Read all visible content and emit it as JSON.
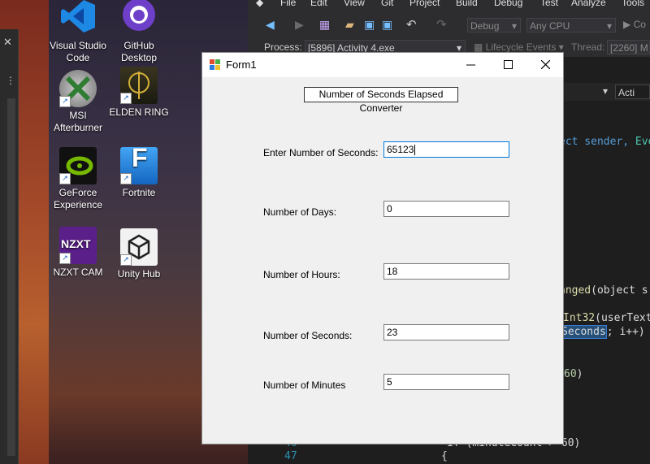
{
  "desktop": {
    "icons": [
      {
        "label": "Visual Studio Code",
        "icon": "vscode-icon",
        "color": "#1e88e5"
      },
      {
        "label": "GitHub Desktop",
        "icon": "github-desktop-icon",
        "color": "#6e40c9"
      },
      {
        "label": "MSI Afterburner",
        "icon": "msi-afterburner-icon",
        "color": "#c0c0c0"
      },
      {
        "label": "ELDEN RING",
        "icon": "elden-ring-icon",
        "color": "#2a2a1a"
      },
      {
        "label": "GeForce Experience",
        "icon": "geforce-experience-icon",
        "color": "#76b900"
      },
      {
        "label": "Fortnite",
        "icon": "fortnite-icon",
        "color": "#2196f3"
      },
      {
        "label": "NZXT CAM",
        "icon": "nzxt-cam-icon",
        "color": "#6a1b9a"
      },
      {
        "label": "Unity Hub",
        "icon": "unity-hub-icon",
        "color": "#f2f2f2"
      }
    ]
  },
  "vs": {
    "menu": [
      "File",
      "Edit",
      "View",
      "Git",
      "Project",
      "Build",
      "Debug",
      "Test",
      "Analyze",
      "Tools"
    ],
    "config": "Debug",
    "platform": "Any CPU",
    "partial_button": "Co",
    "process_label": "Process:",
    "process_value": "[5896] Activity 4.exe",
    "lifecycle": "Lifecycle Events",
    "thread_label": "Thread:",
    "thread_value": "[2260] M",
    "nav_right": "Acti",
    "code": {
      "line1_kw": "ect sender, ",
      "line1_ty": "Eve",
      "line2_fn": "anged",
      "line2_rest": "(object s",
      "line3_fn": "Int32",
      "line3_rest": "(userText",
      "line4_hl": "Seconds",
      "line4_rest": "; i++)",
      "line5_num": "60",
      "line5_rest": ")",
      "line6_text": "if (minuteCount > 60)",
      "line_no_46": "46",
      "line_no_47": "47",
      "brace": "{"
    }
  },
  "form": {
    "title": "Form1",
    "heading": "Number of Seconds Elapsed Converter",
    "fields": [
      {
        "label": "Enter Number of Seconds:",
        "value": "65123"
      },
      {
        "label": "Number of Days:",
        "value": "0"
      },
      {
        "label": "Number of Hours:",
        "value": "18"
      },
      {
        "label": "Number of Seconds:",
        "value": "23"
      },
      {
        "label": "Number of Minutes",
        "value": "5"
      }
    ]
  }
}
